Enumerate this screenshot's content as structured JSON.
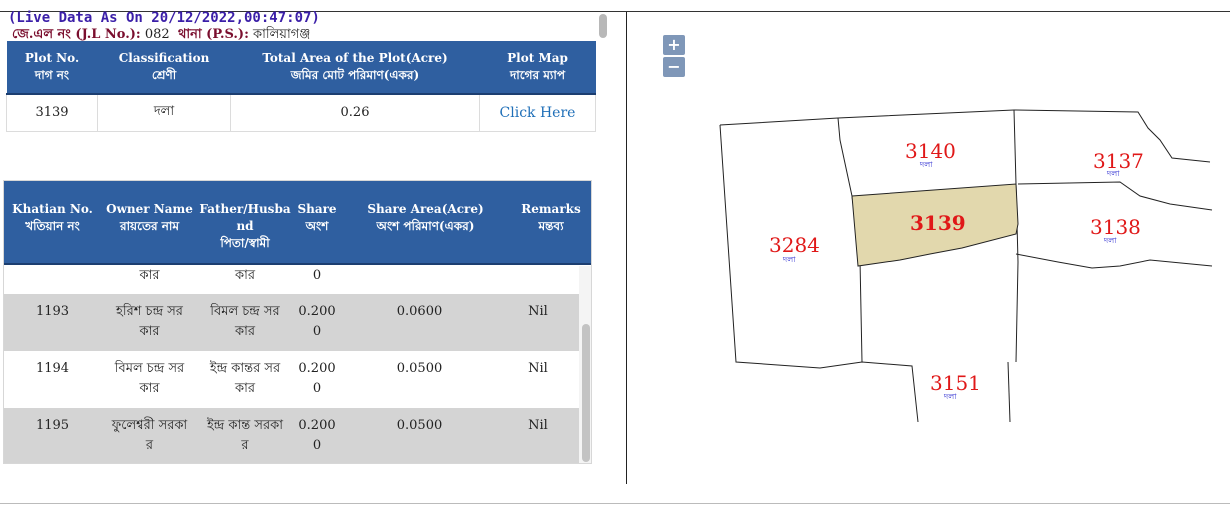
{
  "header": {
    "live_data": "(Live Data As On 20/12/2022,00:47:07)",
    "jl_label": "জে.এল নং (J.L No.):",
    "jl_value": "082",
    "ps_label": "থানা (P.S.):",
    "ps_value": "কালিয়াগঞ্জ"
  },
  "plot_table": {
    "headers": [
      {
        "en": "Plot No.",
        "bn": "দাগ নং"
      },
      {
        "en": "Classification",
        "bn": "শ্রেণী"
      },
      {
        "en": "Total Area of the Plot(Acre)",
        "bn": "জমির মোট পরিমাণ(একর)"
      },
      {
        "en": "Plot Map",
        "bn": "দাগের ম্যাপ"
      }
    ],
    "row": {
      "plot_no": "3139",
      "classification": "দলা",
      "total_area": "0.26",
      "map_link": "Click Here"
    }
  },
  "owner_table": {
    "headers": [
      {
        "en": "Khatian No.",
        "bn": "খতিয়ান নং"
      },
      {
        "en": "Owner Name",
        "bn": "রায়তের নাম"
      },
      {
        "en": "Father/Husba nd",
        "bn": "পিতা/স্বামী"
      },
      {
        "en": "Share",
        "bn": "অংশ"
      },
      {
        "en": "Share Area(Acre)",
        "bn": "অংশ পরিমাণ(একর)"
      },
      {
        "en": "Remarks",
        "bn": "মন্তব্য"
      }
    ],
    "partial_row": {
      "owner": "কার",
      "father": "কার",
      "share": "0"
    },
    "rows": [
      {
        "khatian": "1193",
        "owner_1": "হরিশ চন্দ্র সর",
        "owner_2": "কার",
        "father_1": "বিমল চন্দ্র সর",
        "father_2": "কার",
        "share_1": "0.200",
        "share_2": "0",
        "area": "0.0600",
        "remarks": "Nil"
      },
      {
        "khatian": "1194",
        "owner_1": "বিমল চন্দ্র সর",
        "owner_2": "কার",
        "father_1": "ইন্দ্র কান্তর সর",
        "father_2": "কার",
        "share_1": "0.200",
        "share_2": "0",
        "area": "0.0500",
        "remarks": "Nil"
      },
      {
        "khatian": "1195",
        "owner_1": "ফুলেশ্বরী সরকা",
        "owner_2": "র",
        "father_1": "ইন্দ্র কান্ত সরকা",
        "father_2": "র",
        "share_1": "0.200",
        "share_2": "0",
        "area": "0.0500",
        "remarks": "Nil"
      }
    ]
  },
  "map": {
    "zoom_in": "+",
    "zoom_out": "−",
    "selected_fill": "#e2d8ad",
    "plots": [
      {
        "num": "3140",
        "cls": "দলা"
      },
      {
        "num": "3137",
        "cls": "দলা"
      },
      {
        "num": "3139",
        "cls": ""
      },
      {
        "num": "3138",
        "cls": "দলা"
      },
      {
        "num": "3284",
        "cls": "দলা"
      },
      {
        "num": "3151",
        "cls": "দলা"
      }
    ]
  }
}
